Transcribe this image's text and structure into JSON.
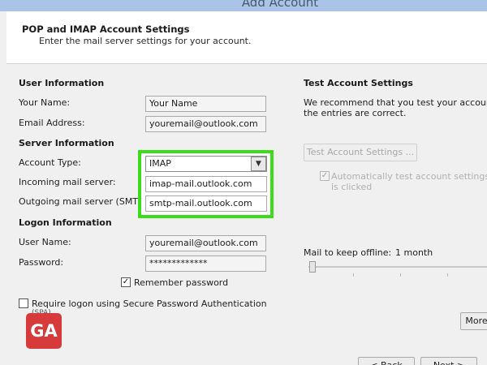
{
  "window": {
    "title": "Add Account"
  },
  "header": {
    "title": "POP and IMAP Account Settings",
    "subtitle": "Enter the mail server settings for your account."
  },
  "user_info": {
    "heading": "User Information",
    "name_label": "Your Name:",
    "name_value": "Your Name",
    "email_label": "Email Address:",
    "email_value": "youremail@outlook.com"
  },
  "server_info": {
    "heading": "Server Information",
    "account_type_label": "Account Type:",
    "account_type_value": "IMAP",
    "incoming_label": "Incoming mail server:",
    "incoming_value": "imap-mail.outlook.com",
    "outgoing_label": "Outgoing mail server (SMTP):",
    "outgoing_value": "smtp-mail.outlook.com",
    "highlight_color": "#3ddc1a"
  },
  "logon_info": {
    "heading": "Logon Information",
    "username_label": "User Name:",
    "username_value": "youremail@outlook.com",
    "password_label": "Password:",
    "password_value": "*************",
    "remember_label": "Remember password",
    "remember_checked": true,
    "spa_label": "Require logon using Secure Password Authentication",
    "spa_label_cont": "(SPA)",
    "spa_checked": false
  },
  "test_settings": {
    "heading": "Test Account Settings",
    "description_line1": "We recommend that you test your account t",
    "description_line2": "the entries are correct.",
    "test_button": "Test Account Settings ...",
    "auto_test_line1": "Automatically test account settings w",
    "auto_test_line2": "is clicked",
    "auto_test_checked": true
  },
  "offline": {
    "label": "Mail to keep offline:",
    "value": "1 month",
    "slider_position": 0
  },
  "buttons": {
    "more": "More",
    "back": "< Back",
    "next": "Next >"
  },
  "watermark": {
    "text": "GA",
    "color": "#d63a3a"
  }
}
